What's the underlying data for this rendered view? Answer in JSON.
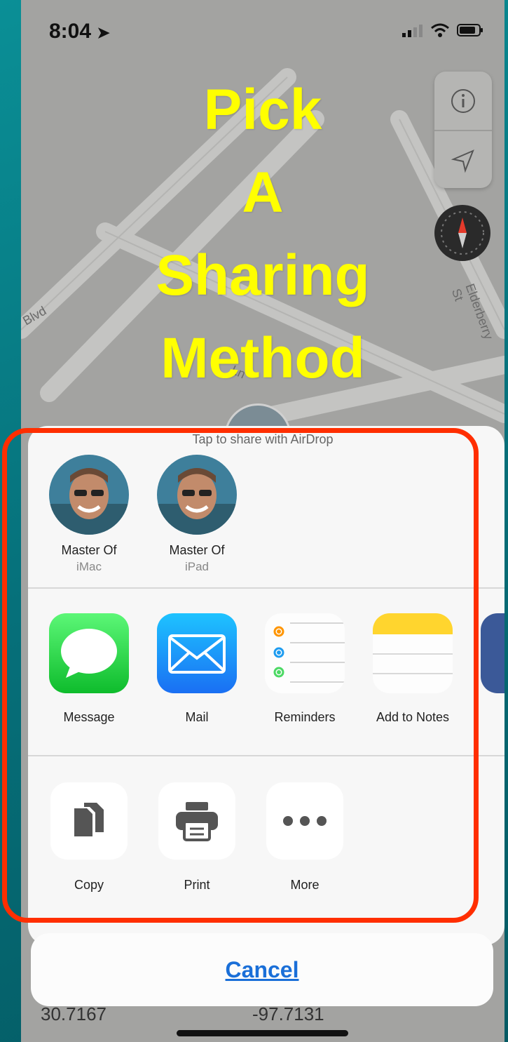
{
  "status_bar": {
    "time": "8:04"
  },
  "map": {
    "streets": [
      "Blvd",
      "Elderberry St",
      "Ln"
    ]
  },
  "headline": {
    "line1": "Pick",
    "line2": "A",
    "line3": "Sharing",
    "line4": "Method"
  },
  "share_sheet": {
    "airdrop_hint": "Tap to share with AirDrop",
    "airdrop_contacts": [
      {
        "name": "Master Of",
        "device": "iMac"
      },
      {
        "name": "Master Of",
        "device": "iPad"
      }
    ],
    "apps": [
      {
        "label": "Message",
        "icon": "message-icon"
      },
      {
        "label": "Mail",
        "icon": "mail-icon"
      },
      {
        "label": "Reminders",
        "icon": "reminders-icon"
      },
      {
        "label": "Add to Notes",
        "icon": "notes-icon"
      }
    ],
    "actions": [
      {
        "label": "Copy",
        "icon": "copy-icon"
      },
      {
        "label": "Print",
        "icon": "print-icon"
      },
      {
        "label": "More",
        "icon": "more-icon"
      }
    ],
    "cancel_label": "Cancel"
  },
  "coordinates": {
    "latitude": "30.7167",
    "longitude": "-97.7131"
  },
  "colors": {
    "headline": "#ffff00",
    "frame": "#ff2e00",
    "link": "#1a6fd8",
    "background": "#0a8f96"
  }
}
